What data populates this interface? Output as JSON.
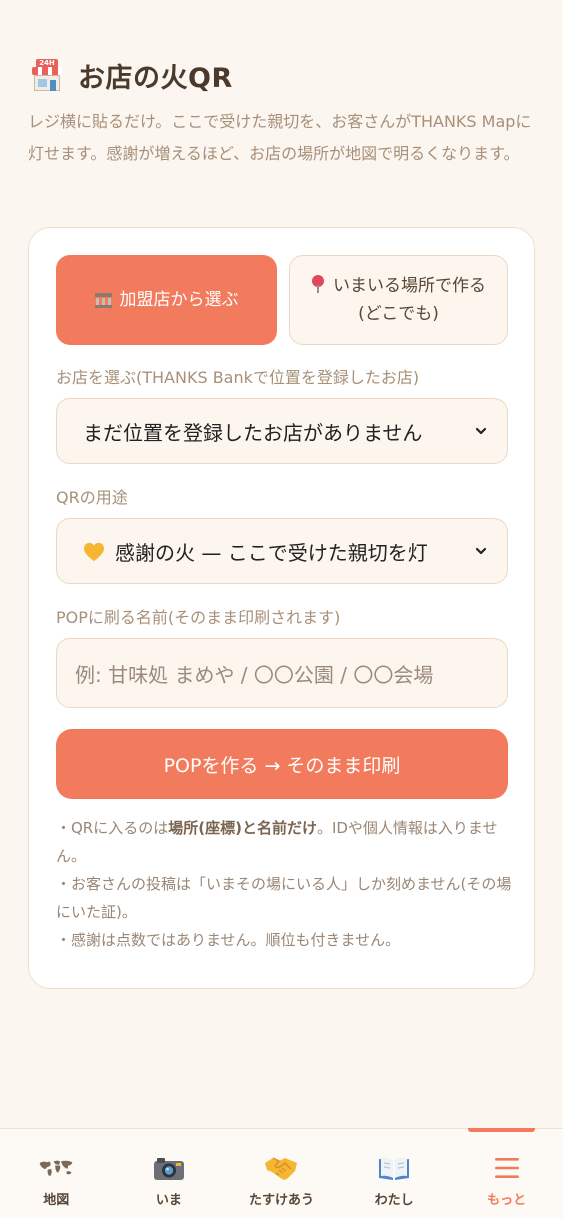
{
  "header": {
    "icon": "convenience-store-icon",
    "store_sign": "24H",
    "title": "お店の火QR",
    "intro": "レジ横に貼るだけ。ここで受けた親切を、お客さんがTHANKS Mapに灯せます。感謝が増えるほど、お店の場所が地図で明るくなります。"
  },
  "mode": {
    "primary_label": "加盟店から選ぶ",
    "primary_icon": "bank-icon",
    "secondary_label": "いまいる場所で作る(どこでも)",
    "secondary_icon": "pin-icon"
  },
  "store_select": {
    "label": "お店を選ぶ(THANKS Bankで位置を登録したお店)",
    "value": "まだ位置を登録したお店がありません"
  },
  "purpose_select": {
    "label": "QRの用途",
    "icon": "yellow-heart-icon",
    "value": "感謝の火 — ここで受けた親切を灯"
  },
  "name_input": {
    "label": "POPに刷る名前(そのまま印刷されます)",
    "placeholder": "例: 甘味処 まめや / 〇〇公園 / 〇〇会場"
  },
  "cta": {
    "label": "POPを作る → そのまま印刷"
  },
  "notes": {
    "n1_pre": "・QRに入るのは",
    "n1_bold": "場所(座標)と名前だけ",
    "n1_post": "。IDや個人情報は入りません。",
    "n2": "・お客さんの投稿は「いまその場にいる人」しか刻めません(その場にいた証)。",
    "n3": "・感謝は点数ではありません。順位も付きません。"
  },
  "tabs": [
    {
      "label": "地図",
      "icon": "world-map-icon"
    },
    {
      "label": "いま",
      "icon": "camera-icon"
    },
    {
      "label": "たすけあう",
      "icon": "handshake-icon"
    },
    {
      "label": "わたし",
      "icon": "book-icon"
    },
    {
      "label": "もっと",
      "icon": "menu-icon",
      "active": true
    }
  ],
  "colors": {
    "accent": "#f27b5d",
    "background": "#fbf6ef",
    "muted_text": "#a8907a"
  }
}
